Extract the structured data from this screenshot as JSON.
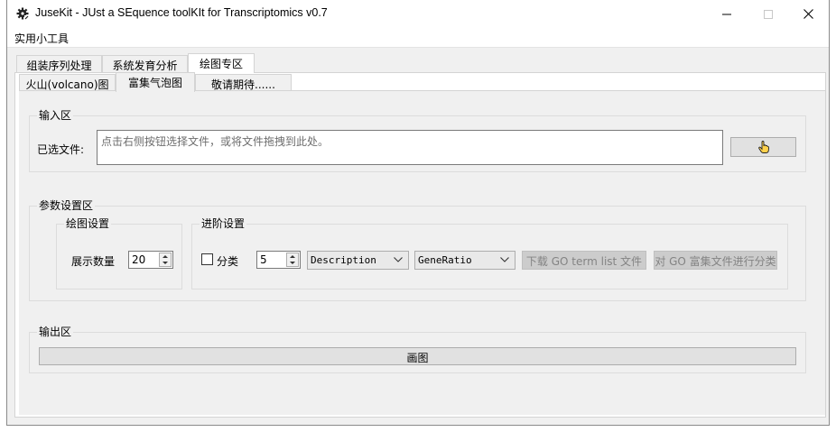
{
  "window": {
    "title": "JuseKit - JUst a SEquence toolKIt for Transcriptomics v0.7",
    "icon": "gear-icon"
  },
  "menu": {
    "tools": "实用小工具"
  },
  "main_tabs": [
    {
      "label": "组装序列处理"
    },
    {
      "label": "系统发育分析"
    },
    {
      "label": "绘图专区",
      "active": true
    }
  ],
  "sub_tabs": [
    {
      "label": "火山(volcano)图"
    },
    {
      "label": "富集气泡图",
      "active": true
    },
    {
      "label": "敬请期待......"
    }
  ],
  "input_section": {
    "title": "输入区",
    "file_label": "已选文件:",
    "file_placeholder": "点击右侧按钮选择文件，或将文件拖拽到此处。",
    "browse_icon": "pointer-hand-icon"
  },
  "params_section": {
    "title": "参数设置区",
    "plot_settings": {
      "title": "绘图设置",
      "count_label": "展示数量",
      "count_value": "20"
    },
    "advanced_settings": {
      "title": "进阶设置",
      "classify_label": "分类",
      "classify_checked": false,
      "classify_value": "5",
      "column_select": "Description",
      "x_select": "GeneRatio",
      "download_button": "下载 GO term list 文件",
      "classify_button": "对 GO 富集文件进行分类"
    }
  },
  "output_section": {
    "title": "输出区",
    "draw_button": "画图"
  }
}
